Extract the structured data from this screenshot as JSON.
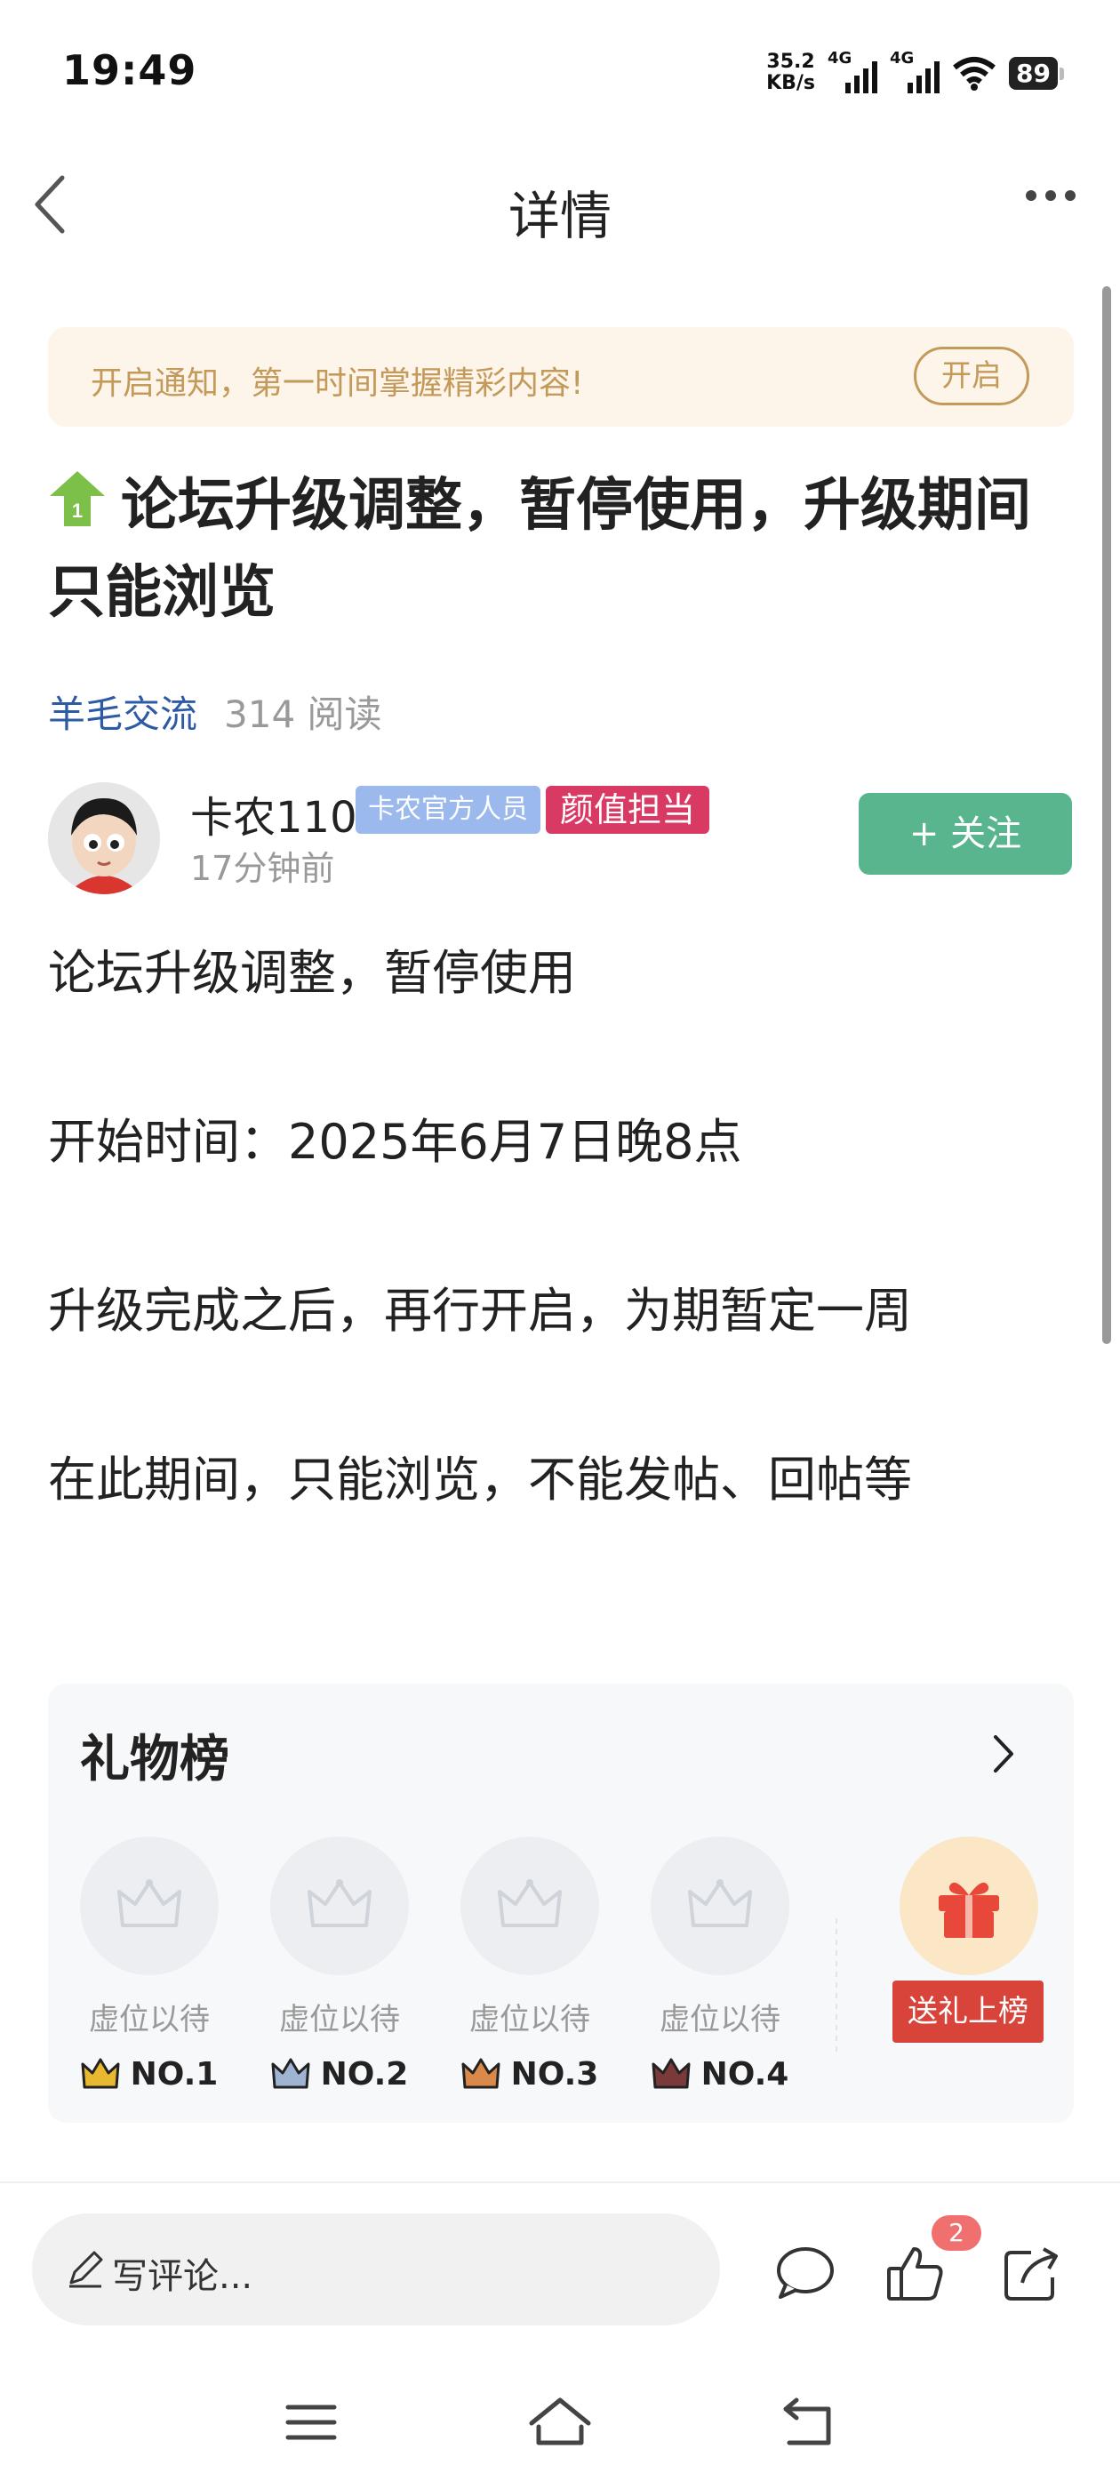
{
  "status_bar": {
    "time": "19:49",
    "net_speed_value": "35.2",
    "net_speed_unit": "KB/s",
    "signal1_label": "4G",
    "signal2_label": "4G",
    "battery": "89"
  },
  "header": {
    "title": "详情"
  },
  "notice": {
    "text": "开启通知，第一时间掌握精彩内容!",
    "button": "开启"
  },
  "post": {
    "rank_badge": "1",
    "title": "论坛升级调整，暂停使用，升级期间只能浏览",
    "category": "羊毛交流",
    "reads": "314 阅读",
    "author": {
      "name": "卡农110",
      "badge_official": "卡农官方人员",
      "badge_looks": "颜值担当",
      "time": "17分钟前",
      "follow_label": "+ 关注"
    },
    "paragraphs": [
      "论坛升级调整，暂停使用",
      "开始时间：2025年6月7日晚8点",
      "升级完成之后，再行开启，为期暂定一周",
      "在此期间，只能浏览，不能发帖、回帖等"
    ]
  },
  "gift_ranking": {
    "title": "礼物榜",
    "slots": [
      {
        "label": "虚位以待",
        "rank": "NO.1",
        "crown_color": "#e8b830"
      },
      {
        "label": "虚位以待",
        "rank": "NO.2",
        "crown_color": "#9fb4d3"
      },
      {
        "label": "虚位以待",
        "rank": "NO.3",
        "crown_color": "#d98a4a"
      },
      {
        "label": "虚位以待",
        "rank": "NO.4",
        "crown_color": "#7a3a3a"
      }
    ],
    "send_button": "送礼上榜"
  },
  "bottom_bar": {
    "comment_placeholder": "写评论...",
    "like_count": "2"
  },
  "colors": {
    "accent_green": "#58b58d",
    "category_blue": "#2d5aa5",
    "notice_gold": "#c49a5a",
    "badge_pink": "#d93a63",
    "gift_red": "#d8443a"
  }
}
